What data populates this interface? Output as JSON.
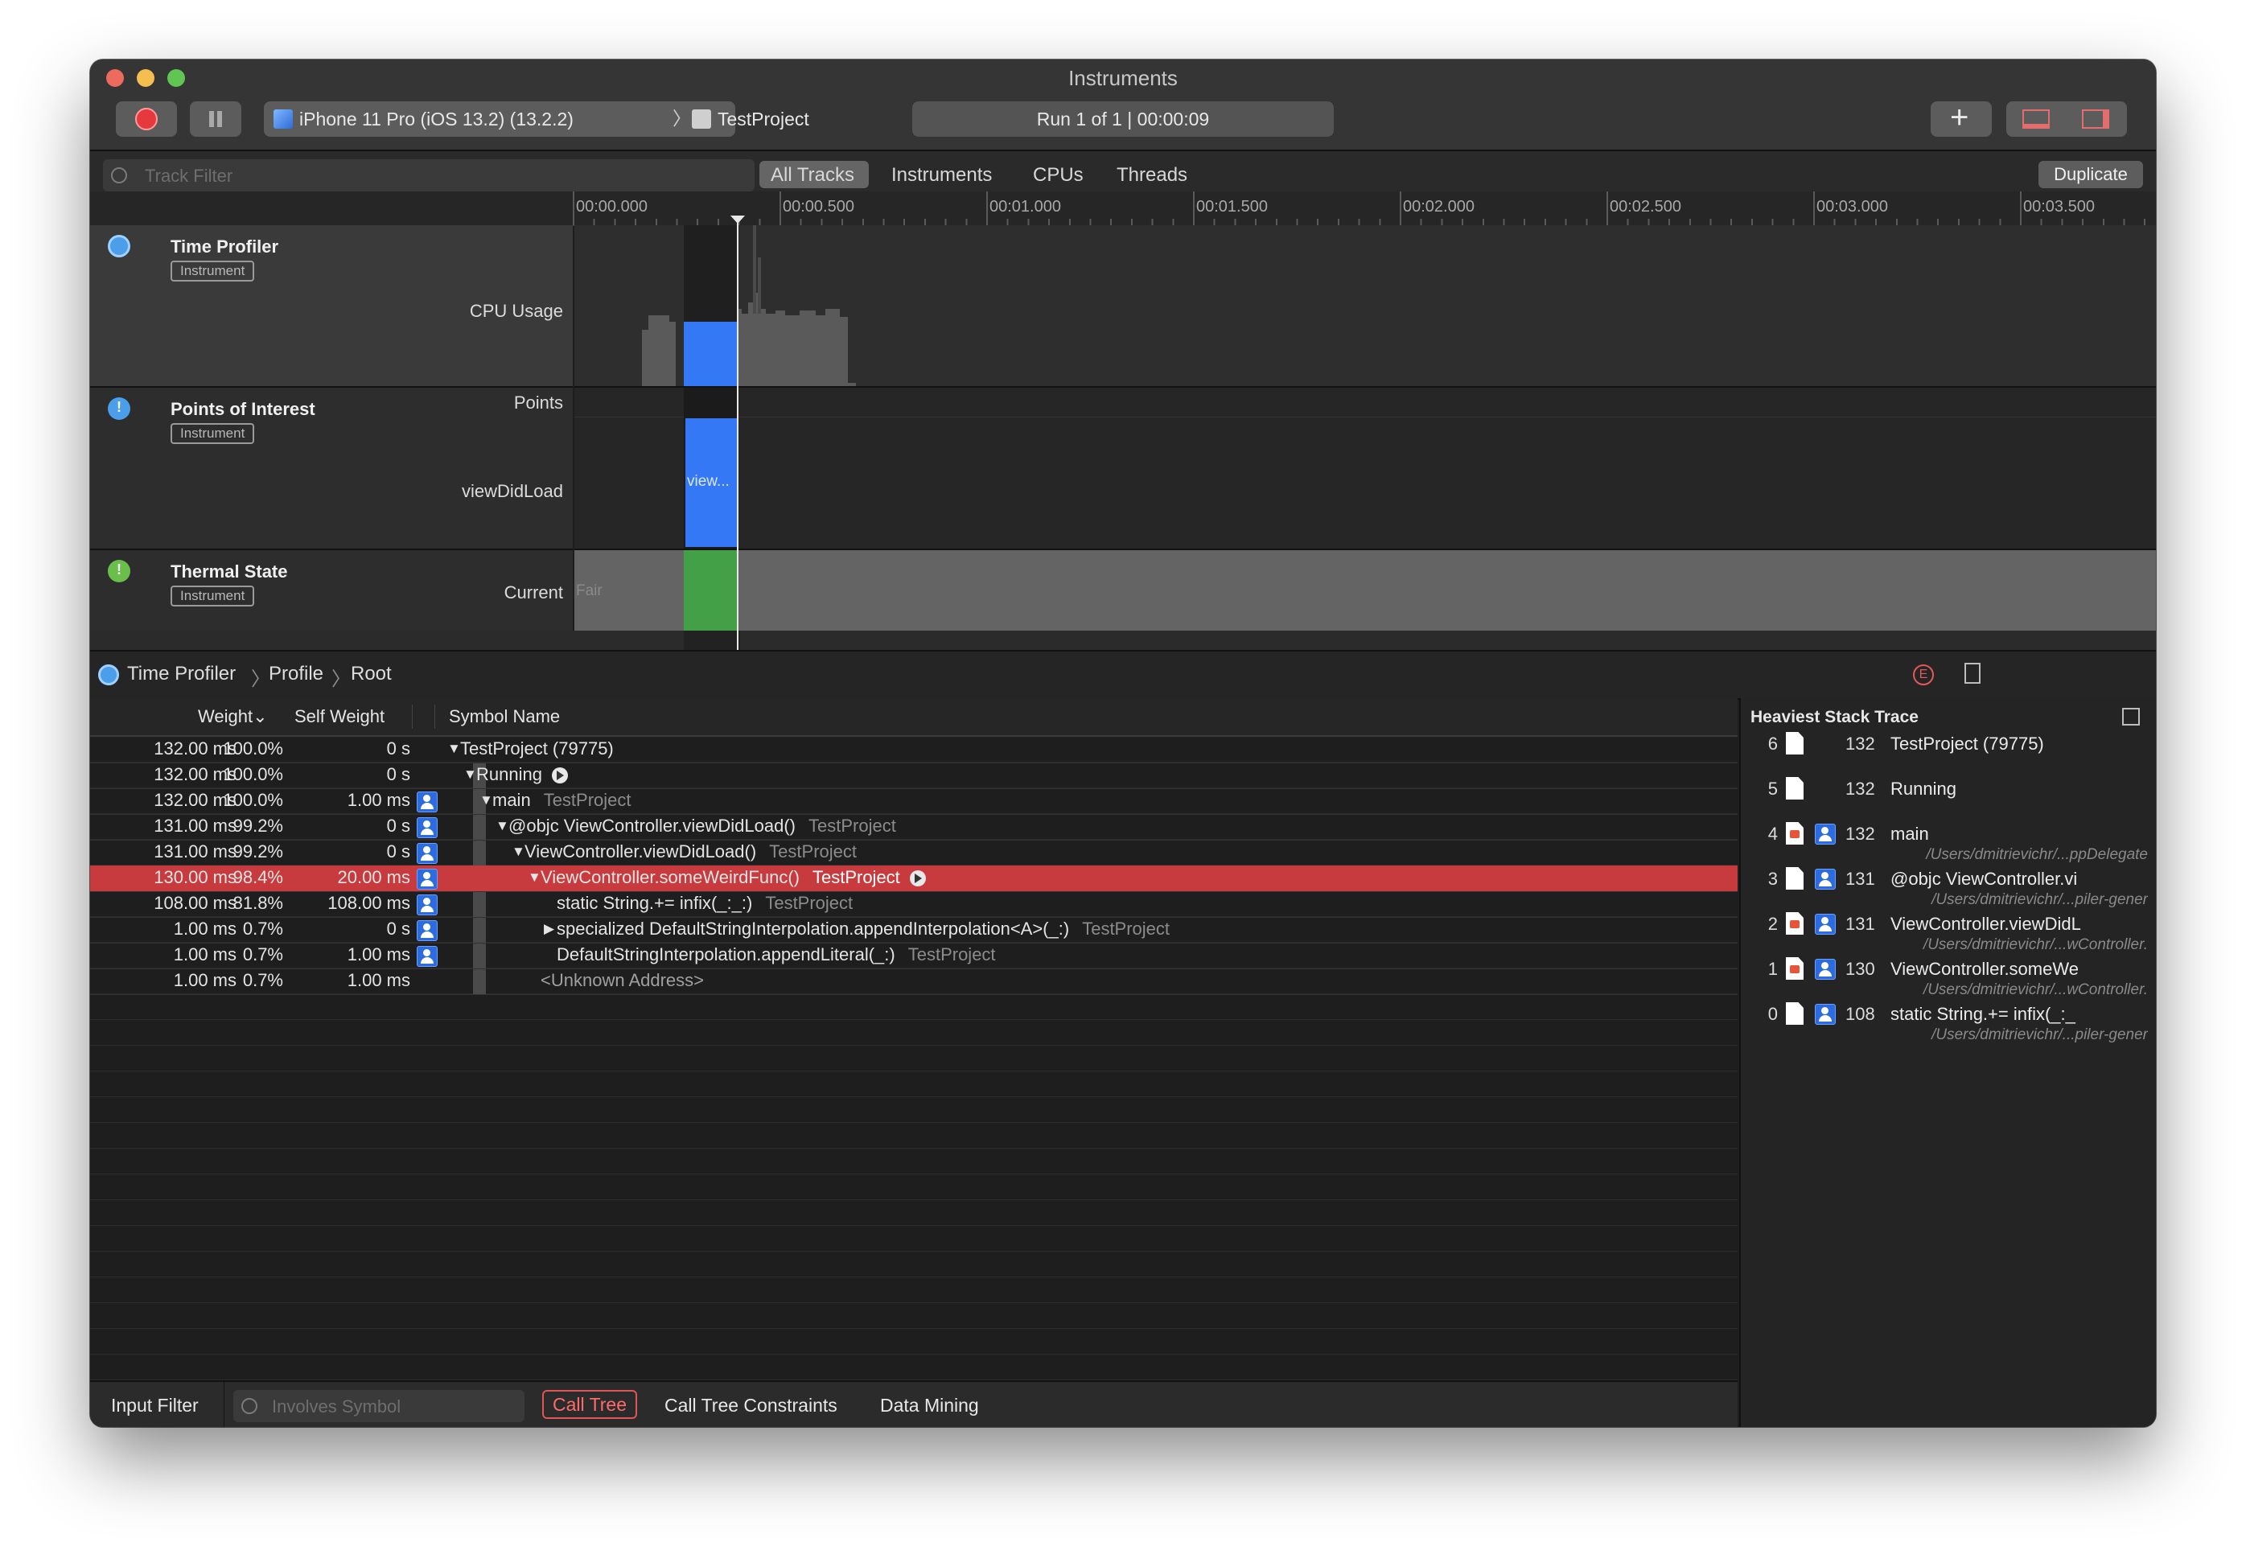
{
  "window": {
    "title": "Instruments"
  },
  "toolbar": {
    "device": "iPhone 11 Pro (iOS 13.2) (13.2.2)",
    "target": "TestProject",
    "run_status": "Run 1 of 1  |  00:00:09"
  },
  "filterbar": {
    "track_filter_placeholder": "Track Filter",
    "tabs": [
      "All Tracks",
      "Instruments",
      "CPUs",
      "Threads"
    ],
    "selected_tab": "All Tracks",
    "duplicate": "Duplicate"
  },
  "ruler": {
    "ticks": [
      "00:00.000",
      "00:00.500",
      "00:01.000",
      "00:01.500",
      "00:02.000",
      "00:02.500",
      "00:03.000",
      "00:03.500"
    ]
  },
  "tracks": [
    {
      "name": "Time Profiler",
      "badge": "Instrument",
      "sub": "CPU Usage"
    },
    {
      "name": "Points of Interest",
      "badge": "Instrument",
      "sub_top": "Points",
      "sub": "viewDidLoad",
      "interval_label": "view..."
    },
    {
      "name": "Thermal State",
      "badge": "Instrument",
      "sub": "Current",
      "state": "Fair"
    }
  ],
  "breadcrumb": [
    "Time Profiler",
    "Profile",
    "Root"
  ],
  "table": {
    "headers": {
      "weight": "Weight",
      "self_weight": "Self Weight",
      "symbol": "Symbol Name"
    },
    "rows": [
      {
        "ms": "132.00 ms",
        "pct": "100.0%",
        "self": "0 s",
        "symbol": "TestProject (79775)",
        "lib": "",
        "arrow": "▼",
        "indent": 0,
        "user": false
      },
      {
        "ms": "132.00 ms",
        "pct": "100.0%",
        "self": "0 s",
        "symbol": "Running",
        "lib": "",
        "arrow": "▼",
        "indent": 1,
        "user": false
      },
      {
        "ms": "132.00 ms",
        "pct": "100.0%",
        "self": "1.00 ms",
        "symbol": "main",
        "lib": "TestProject",
        "arrow": "▼",
        "indent": 2,
        "user": true
      },
      {
        "ms": "131.00 ms",
        "pct": "99.2%",
        "self": "0 s",
        "symbol": "@objc ViewController.viewDidLoad()",
        "lib": "TestProject",
        "arrow": "▼",
        "indent": 3,
        "user": true
      },
      {
        "ms": "131.00 ms",
        "pct": "99.2%",
        "self": "0 s",
        "symbol": "ViewController.viewDidLoad()",
        "lib": "TestProject",
        "arrow": "▼",
        "indent": 4,
        "user": true
      },
      {
        "ms": "130.00 ms",
        "pct": "98.4%",
        "self": "20.00 ms",
        "symbol": "ViewController.someWeirdFunc()",
        "lib": "TestProject",
        "arrow": "▼",
        "indent": 5,
        "user": true,
        "selected": true
      },
      {
        "ms": "108.00 ms",
        "pct": "81.8%",
        "self": "108.00 ms",
        "symbol": "static String.+= infix(_:_:)",
        "lib": "TestProject",
        "arrow": "",
        "indent": 6,
        "user": true
      },
      {
        "ms": "1.00 ms",
        "pct": "0.7%",
        "self": "0 s",
        "symbol": "specialized DefaultStringInterpolation.appendInterpolation<A>(_:)",
        "lib": "TestProject",
        "arrow": "▶",
        "indent": 6,
        "user": true
      },
      {
        "ms": "1.00 ms",
        "pct": "0.7%",
        "self": "1.00 ms",
        "symbol": "DefaultStringInterpolation.appendLiteral(_:)",
        "lib": "TestProject",
        "arrow": "",
        "indent": 6,
        "user": true
      },
      {
        "ms": "1.00 ms",
        "pct": "0.7%",
        "self": "1.00 ms",
        "symbol": "<Unknown Address>",
        "lib": "",
        "arrow": "",
        "indent": 5,
        "user": false,
        "dim": true
      }
    ]
  },
  "stack_trace": {
    "title": "Heaviest Stack Trace",
    "frames": [
      {
        "idx": "6",
        "weight": "132",
        "name": "TestProject (79775)",
        "path": "",
        "kind": "file"
      },
      {
        "idx": "5",
        "weight": "132",
        "name": "Running",
        "path": "",
        "kind": "file"
      },
      {
        "idx": "4",
        "weight": "132",
        "name": "main",
        "path": "/Users/dmitrievichr/...ppDelegate",
        "kind": "swift"
      },
      {
        "idx": "3",
        "weight": "131",
        "name": "@objc ViewController.vi",
        "path": "/Users/dmitrievichr/...piler-gener",
        "kind": "file"
      },
      {
        "idx": "2",
        "weight": "131",
        "name": "ViewController.viewDidL",
        "path": "/Users/dmitrievichr/...wController.",
        "kind": "swift"
      },
      {
        "idx": "1",
        "weight": "130",
        "name": "ViewController.someWe",
        "path": "/Users/dmitrievichr/...wController.",
        "kind": "swift"
      },
      {
        "idx": "0",
        "weight": "108",
        "name": "static String.+= infix(_:_",
        "path": "/Users/dmitrievichr/...piler-gener",
        "kind": "file"
      }
    ]
  },
  "bottombar": {
    "input_filter": "Input Filter",
    "involves_placeholder": "Involves Symbol",
    "call_tree": "Call Tree",
    "constraints": "Call Tree Constraints",
    "data_mining": "Data Mining"
  },
  "colors": {
    "selection": "#c73b3e",
    "interval": "#3478f6",
    "thermal": "#43a047"
  }
}
